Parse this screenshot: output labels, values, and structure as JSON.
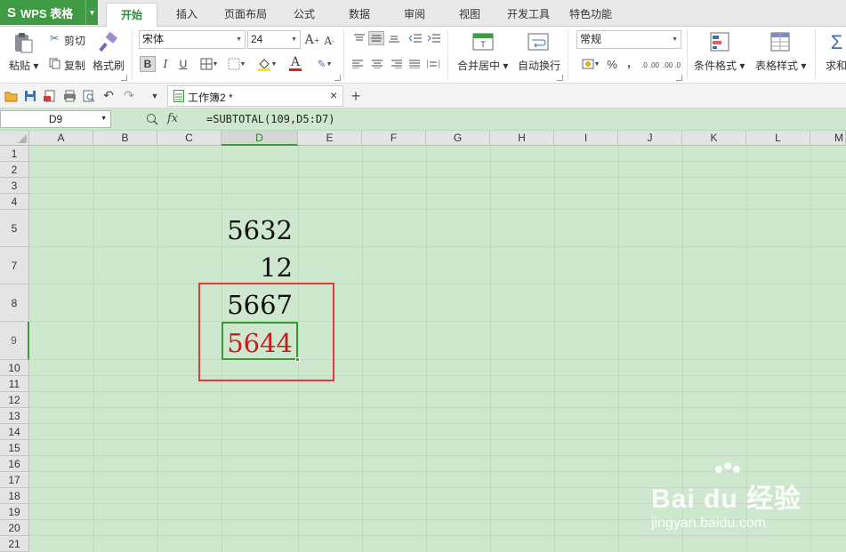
{
  "app": {
    "name": "WPS 表格",
    "logo_glyph": "S"
  },
  "tabs": [
    "开始",
    "插入",
    "页面布局",
    "公式",
    "数据",
    "审阅",
    "视图",
    "开发工具",
    "特色功能"
  ],
  "active_tab": "开始",
  "ribbon": {
    "paste": "粘贴",
    "cut": "剪切",
    "copy": "复制",
    "format_painter": "格式刷",
    "font_name": "宋体",
    "font_size": "24",
    "bold": "B",
    "italic": "I",
    "underline": "U",
    "font_color_letter": "A",
    "merge_center": "合并居中",
    "wrap_text": "自动换行",
    "number_format": "常规",
    "percent": "%",
    "comma": "‚",
    "decimal_inc": ".0 .00",
    "decimal_dec": ".00 .0",
    "conditional_format": "条件格式",
    "table_style": "表格样式",
    "sum": "求和",
    "sigma": "Σ"
  },
  "document_tab": {
    "title": "工作簿2 *",
    "close": "×",
    "add": "+"
  },
  "formula_bar": {
    "name_box": "D9",
    "fx": "fx",
    "formula": "=SUBTOTAL(109,D5:D7)"
  },
  "columns": [
    "A",
    "B",
    "C",
    "D",
    "E",
    "F",
    "G",
    "H",
    "I",
    "J",
    "K",
    "L",
    "M"
  ],
  "selected_column": "D",
  "rows": [
    "1",
    "2",
    "3",
    "4",
    "5",
    "7",
    "8",
    "9",
    "10",
    "11",
    "12",
    "13",
    "14",
    "15",
    "16",
    "17",
    "18",
    "19",
    "20",
    "21"
  ],
  "selected_row": "9",
  "cells": {
    "D5": "5632",
    "D7": "12",
    "D8": "5667",
    "D9": "5644"
  },
  "colors": {
    "accent": "#3e9b44",
    "sheet_bg": "#cde8cd",
    "highlight": "#e23b3b",
    "result_text": "#d0181f"
  },
  "watermark": {
    "brand": "Bai du 经验",
    "url": "jingyan.baidu.com"
  }
}
